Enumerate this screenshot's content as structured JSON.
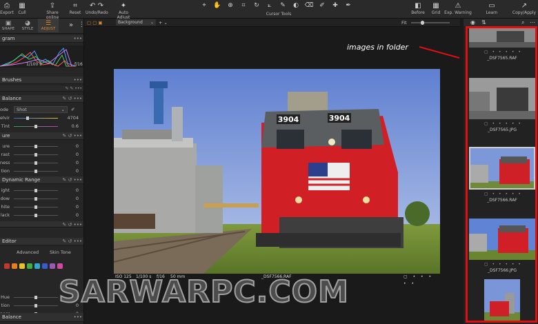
{
  "toolbar": {
    "left_items": [
      {
        "label": "Export",
        "icon": "export-icon"
      },
      {
        "label": "Cull",
        "icon": "cull-icon"
      },
      {
        "label": "Share online",
        "icon": "share-icon"
      },
      {
        "label": "Reset",
        "icon": "reset-icon"
      },
      {
        "label": "Undo/Redo",
        "icon": "undo-icon"
      },
      {
        "label": "Auto Adjust",
        "icon": "auto-adjust-icon"
      }
    ],
    "cursor_tools_label": "Cursor Tools",
    "right_items": [
      {
        "label": "Before",
        "icon": "before-icon"
      },
      {
        "label": "Grid",
        "icon": "grid-icon"
      },
      {
        "label": "Exp. Warning",
        "icon": "warning-icon"
      },
      {
        "label": "Learn",
        "icon": "learn-icon"
      },
      {
        "label": "Copy/Apply",
        "icon": "copy-apply-icon"
      }
    ]
  },
  "left_panel": {
    "tabs": [
      "SHAPE",
      "STYLE",
      "ADJUST"
    ],
    "active_tab": "ADJUST",
    "histogram_title": "gram",
    "histogram_shutter": "1/100 s",
    "histogram_aperture": "f/16",
    "brushes_title": "Brushes",
    "wb_title": "Balance",
    "wb_mode_label": "ode",
    "wb_mode_value": "Shot",
    "wb_rows": [
      {
        "label": "elvin",
        "value": "4704"
      },
      {
        "label": "Tint",
        "value": "0.6"
      }
    ],
    "exposure_title": "ure",
    "exposure_rows": [
      {
        "label": "ure",
        "value": "0"
      },
      {
        "label": "rast",
        "value": "0"
      },
      {
        "label": "ness",
        "value": "0"
      },
      {
        "label": "tion",
        "value": "0"
      }
    ],
    "dr_title": "Dynamic Range",
    "dr_rows": [
      {
        "label": "ight",
        "value": "0"
      },
      {
        "label": "dow",
        "value": "0"
      },
      {
        "label": "hite",
        "value": "0"
      },
      {
        "label": "lack",
        "value": "0"
      }
    ],
    "editor_title": "Editor",
    "editor_tabs": [
      "Advanced",
      "Skin Tone"
    ],
    "editor_rows": [
      {
        "label": "Hue",
        "value": "0"
      },
      {
        "label": "tion",
        "value": "0"
      },
      {
        "label": "ness",
        "value": "0"
      }
    ],
    "bottom_title": "Balance",
    "swatches": [
      "#c0392b",
      "#e67e22",
      "#e5c32a",
      "#3fae49",
      "#34a8c9",
      "#3a5bd0",
      "#9b59b6",
      "#d04aa0"
    ]
  },
  "viewer": {
    "layer_select": "Background",
    "fit_label": "Fit",
    "caption_iso": "ISO 125",
    "caption_shutter": "1/100 s",
    "caption_aperture": "f/16",
    "caption_focal": "50 mm",
    "caption_filename": "_DSF7566.RAF",
    "locomotive_number": "3904"
  },
  "filmstrip": {
    "thumbs": [
      {
        "label": "_DSF7565.RAF"
      },
      {
        "label": "_DSF7565.JPG"
      },
      {
        "label": "_DSF7566.RAF"
      },
      {
        "label": "_DSF7566.JPG"
      }
    ]
  },
  "annotation": "images in folder",
  "watermark": "SARWARPC.COM"
}
